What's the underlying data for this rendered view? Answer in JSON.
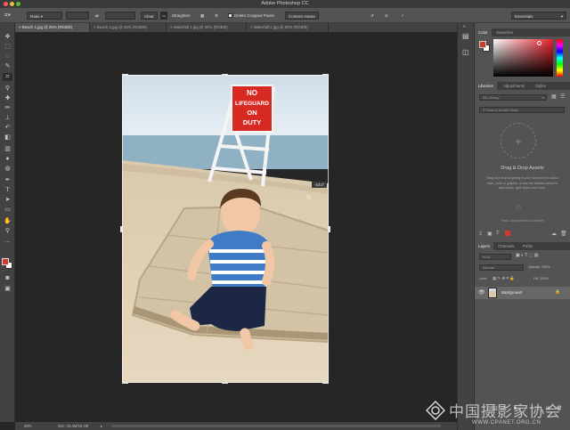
{
  "window": {
    "title": "Adobe Photoshop CC",
    "traffic_colors": [
      "#fc5b57",
      "#e5bf3c",
      "#57c038"
    ]
  },
  "options_bar": {
    "ratio_label": "Ratio",
    "clear_label": "Clear",
    "straighten_label": "Straighten",
    "delete_cropped_label": "Delete Cropped Pixels",
    "content_aware_label": "Content-Aware",
    "workspace_label": "Essentials"
  },
  "tabs": [
    {
      "label": "Beach 1.jpg @ 25% (RGB/8)",
      "active": true
    },
    {
      "label": "Beach 2.jpg @ 25% (RGB/8)",
      "active": false
    },
    {
      "label": "Waterfall 1.jpg @ 50% (RGB/8)",
      "active": false
    },
    {
      "label": "Waterfall 2.jpg @ 50% (RGB/8)",
      "active": false
    }
  ],
  "canvas": {
    "sign_lines": [
      "NO",
      "LIFEGUARD",
      "ON",
      "DUTY"
    ],
    "angle_readout": "-43.0°"
  },
  "status": {
    "zoom": "25%",
    "doc_size": "Doc: 18.4M/18.4M"
  },
  "color_panel": {
    "tabs": [
      "Color",
      "Swatches"
    ],
    "foreground": "#d13a2e",
    "background": "#ffffff"
  },
  "libraries_panel": {
    "tabs": [
      "Libraries",
      "Adjustments",
      "Styles"
    ],
    "library_name": "My Library",
    "search_placeholder": "Search Adobe Stock",
    "empty_title": "Drag & Drop Assets",
    "empty_body": "Drag and drop anything in your document to add a style, color or graphic, or use the buttons below to add colors, type styles and more.",
    "view_link": "View Library from Document"
  },
  "layers_panel": {
    "tabs": [
      "Layers",
      "Channels",
      "Paths"
    ],
    "filter_label": "Kind",
    "blend_mode": "Normal",
    "opacity_label": "Opacity: 100%",
    "lock_label": "Lock:",
    "fill_label": "Fill: 100%",
    "layer_name": "Background"
  },
  "watermark": {
    "text": "中国摄影家协会",
    "subtext": "WWW.CPANET.ORG.CN"
  }
}
